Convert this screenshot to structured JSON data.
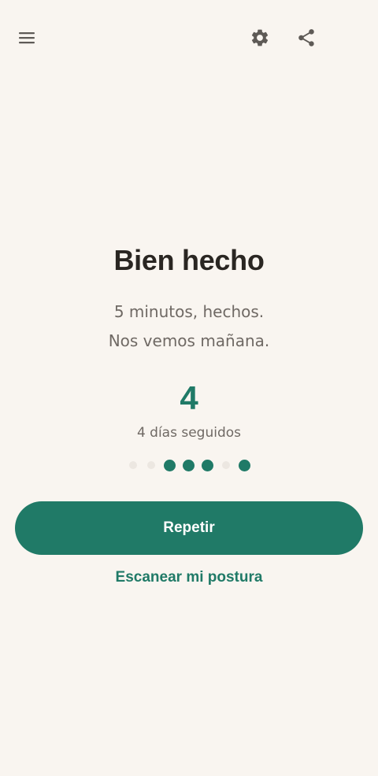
{
  "topbar": {
    "menu_icon": "hamburger-menu-icon",
    "settings_icon": "gear-icon",
    "share_icon": "share-icon"
  },
  "main": {
    "title": "Bien hecho",
    "subtitle_line1": "5 minutos, hechos.",
    "subtitle_line2": "Nos vemos mañana.",
    "streak_number": "4",
    "streak_label": "4 días seguidos",
    "streak_days": [
      false,
      false,
      true,
      true,
      true,
      false,
      true
    ]
  },
  "actions": {
    "primary_label": "Repetir",
    "secondary_label": "Escanear mi postura"
  },
  "colors": {
    "background": "#f9f5f0",
    "accent": "#207a67",
    "text_dark": "#2a2622",
    "text_muted": "#6f6964",
    "dot_inactive": "#ece7e1"
  }
}
